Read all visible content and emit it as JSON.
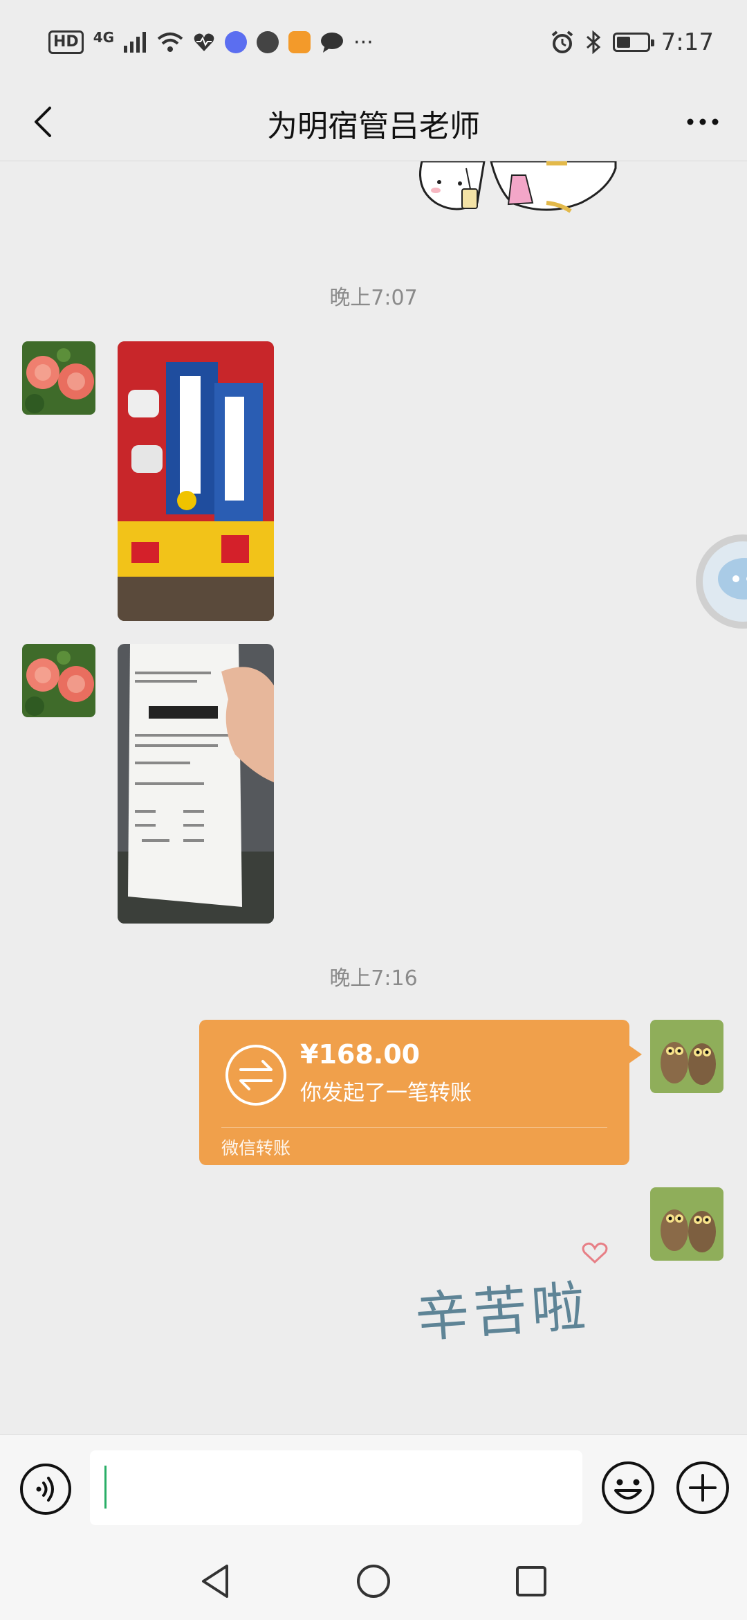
{
  "status_bar": {
    "hd_badge": "HD",
    "network": "4G",
    "overflow_dots": "···",
    "time": "7:17",
    "battery_level": 0.45
  },
  "header": {
    "title": "为明宿管吕老师"
  },
  "messages": [
    {
      "type": "sticker",
      "side": "right",
      "description_icon": "sticker-cartoon-drinking"
    },
    {
      "type": "time",
      "text": "晚上7:07"
    },
    {
      "type": "image",
      "side": "left",
      "icon": "photo-mosquito-liquid-box"
    },
    {
      "type": "image",
      "side": "left",
      "icon": "photo-receipt"
    },
    {
      "type": "time",
      "text": "晚上7:16"
    },
    {
      "type": "transfer",
      "side": "right",
      "amount": "¥168.00",
      "desc": "你发起了一笔转账",
      "label": "微信转账"
    },
    {
      "type": "sticker",
      "side": "right",
      "text": "辛苦啦"
    }
  ],
  "composer": {
    "placeholder": ""
  },
  "colors": {
    "background": "#ededed",
    "transfer": "#f0a04b",
    "caret": "#2aae67"
  }
}
